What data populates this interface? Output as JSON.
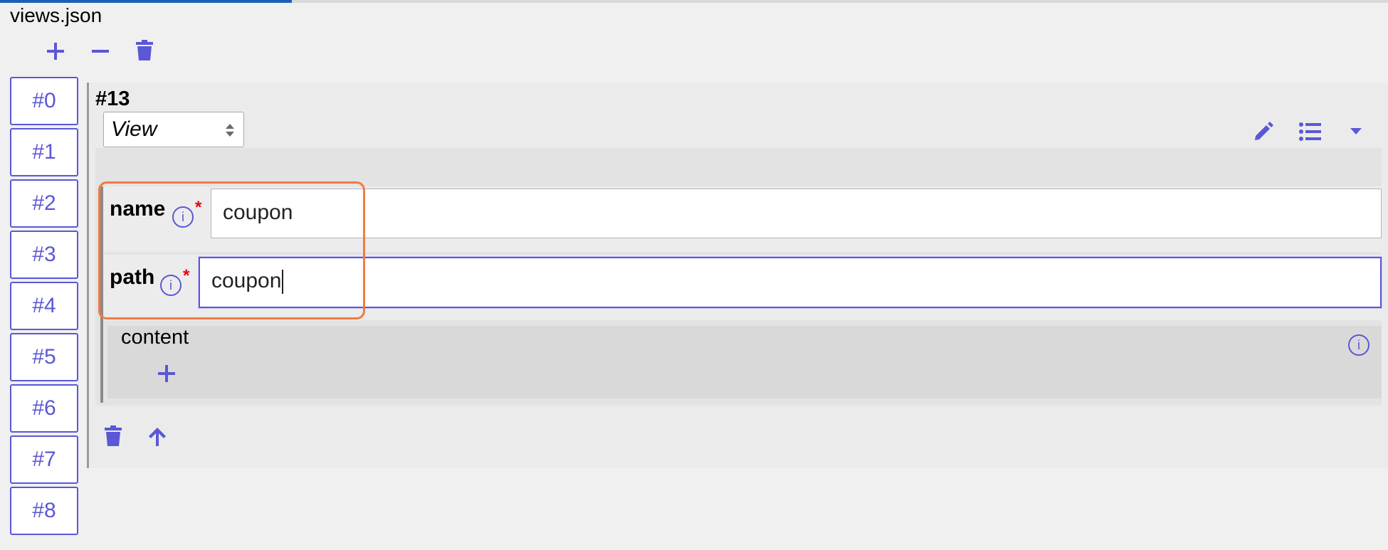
{
  "file": {
    "name": "views.json",
    "progress_fraction": 0.21
  },
  "toolbar": {
    "add_icon": "plus-icon",
    "remove_icon": "minus-icon",
    "delete_icon": "trash-icon"
  },
  "index_items": [
    "#0",
    "#1",
    "#2",
    "#3",
    "#4",
    "#5",
    "#6",
    "#7",
    "#8"
  ],
  "record": {
    "title": "#13",
    "type_value": "View",
    "fields": [
      {
        "label": "name",
        "info": "i",
        "required": "*",
        "value": "coupon"
      },
      {
        "label": "path",
        "info": "i",
        "required": "*",
        "value": "coupon"
      }
    ],
    "content": {
      "label": "content",
      "info": "i"
    }
  },
  "colors": {
    "accent": "#5b57d6",
    "highlight": "#f07b45",
    "required": "#e8000e",
    "progress": "#1f5fb3"
  }
}
